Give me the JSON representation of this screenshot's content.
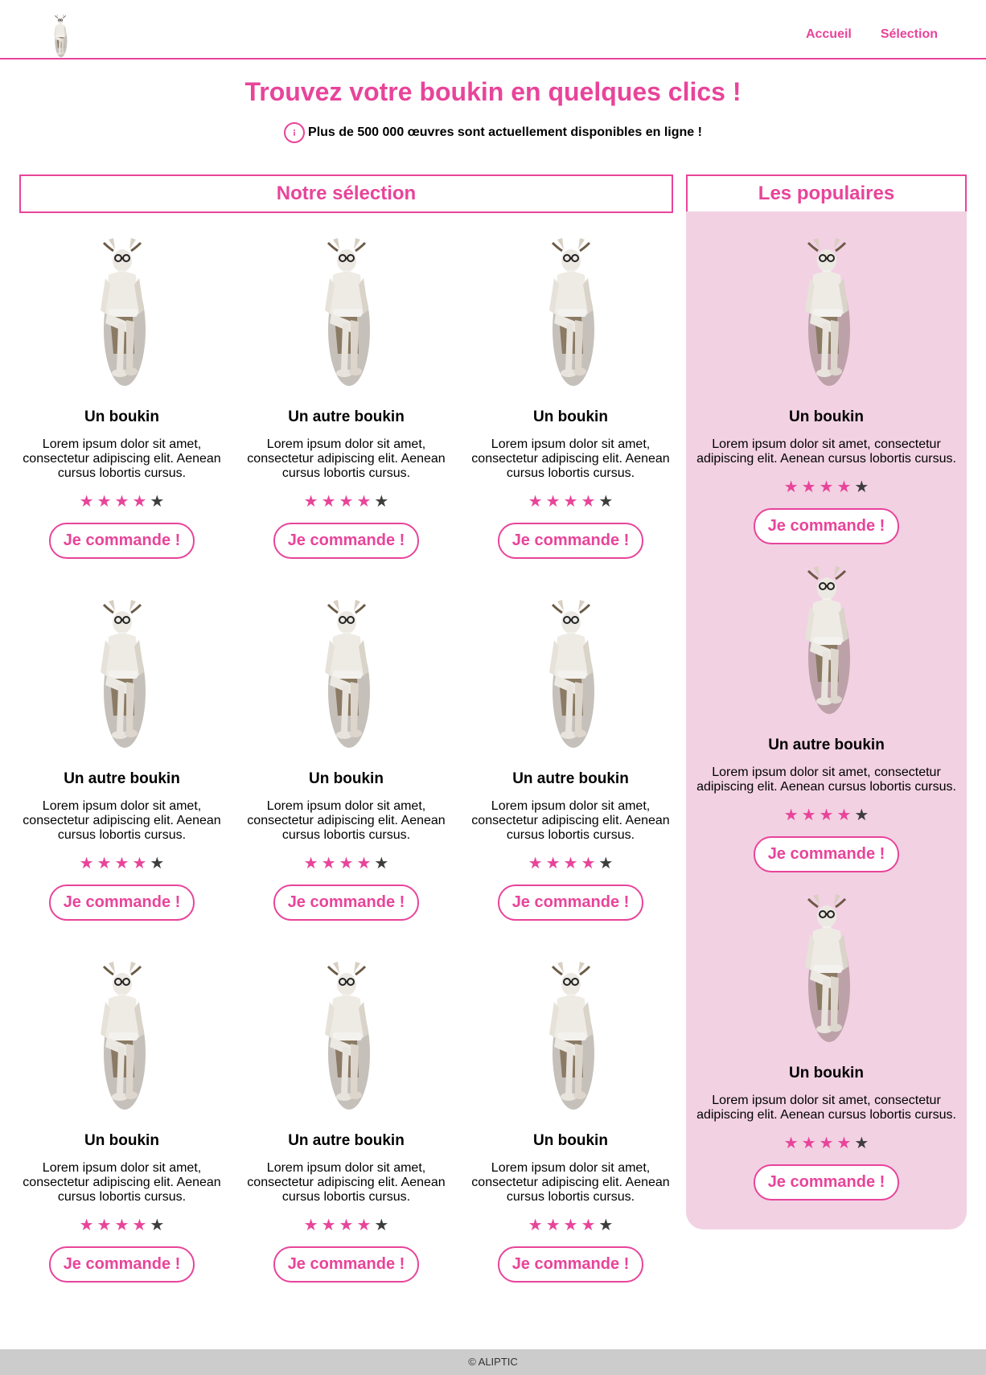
{
  "brand": {
    "accent": "#e8449a",
    "panel_bg": "#f2d1e3",
    "star_off": "#3d3d3d",
    "logo_icon": "goat-statue-logo"
  },
  "nav": {
    "items": [
      {
        "label": "Accueil"
      },
      {
        "label": "Sélection"
      }
    ]
  },
  "hero": {
    "title": "Trouvez votre boukin en quelques clics !",
    "info_icon": "info-icon",
    "info_text": "Plus de 500 000 œuvres sont actuellement disponibles en ligne !"
  },
  "selection": {
    "title": "Notre sélection",
    "books": [
      {
        "title": "Un boukin",
        "description": "Lorem ipsum dolor sit amet, consectetur adipiscing elit. Aenean cursus lobortis cursus.",
        "rating": 4,
        "rating_max": 5,
        "button": "Je commande !"
      },
      {
        "title": "Un autre boukin",
        "description": "Lorem ipsum dolor sit amet, consectetur adipiscing elit. Aenean cursus lobortis cursus.",
        "rating": 4,
        "rating_max": 5,
        "button": "Je commande !"
      },
      {
        "title": "Un boukin",
        "description": "Lorem ipsum dolor sit amet, consectetur adipiscing elit. Aenean cursus lobortis cursus.",
        "rating": 4,
        "rating_max": 5,
        "button": "Je commande !"
      },
      {
        "title": "Un autre boukin",
        "description": "Lorem ipsum dolor sit amet, consectetur adipiscing elit. Aenean cursus lobortis cursus.",
        "rating": 4,
        "rating_max": 5,
        "button": "Je commande !"
      },
      {
        "title": "Un boukin",
        "description": "Lorem ipsum dolor sit amet, consectetur adipiscing elit. Aenean cursus lobortis cursus.",
        "rating": 4,
        "rating_max": 5,
        "button": "Je commande !"
      },
      {
        "title": "Un autre boukin",
        "description": "Lorem ipsum dolor sit amet, consectetur adipiscing elit. Aenean cursus lobortis cursus.",
        "rating": 4,
        "rating_max": 5,
        "button": "Je commande !"
      },
      {
        "title": "Un boukin",
        "description": "Lorem ipsum dolor sit amet, consectetur adipiscing elit. Aenean cursus lobortis cursus.",
        "rating": 4,
        "rating_max": 5,
        "button": "Je commande !"
      },
      {
        "title": "Un autre boukin",
        "description": "Lorem ipsum dolor sit amet, consectetur adipiscing elit. Aenean cursus lobortis cursus.",
        "rating": 4,
        "rating_max": 5,
        "button": "Je commande !"
      },
      {
        "title": "Un boukin",
        "description": "Lorem ipsum dolor sit amet, consectetur adipiscing elit. Aenean cursus lobortis cursus.",
        "rating": 4,
        "rating_max": 5,
        "button": "Je commande !"
      }
    ]
  },
  "popular": {
    "title": "Les populaires",
    "books": [
      {
        "title": "Un boukin",
        "description": "Lorem ipsum dolor sit amet, consectetur adipiscing elit. Aenean cursus lobortis cursus.",
        "rating": 4,
        "rating_max": 5,
        "button": "Je commande !"
      },
      {
        "title": "Un autre boukin",
        "description": "Lorem ipsum dolor sit amet, consectetur adipiscing elit. Aenean cursus lobortis cursus.",
        "rating": 4,
        "rating_max": 5,
        "button": "Je commande !"
      },
      {
        "title": "Un boukin",
        "description": "Lorem ipsum dolor sit amet, consectetur adipiscing elit. Aenean cursus lobortis cursus.",
        "rating": 4,
        "rating_max": 5,
        "button": "Je commande !"
      }
    ]
  },
  "footer": {
    "text": "© ALIPTIC"
  }
}
